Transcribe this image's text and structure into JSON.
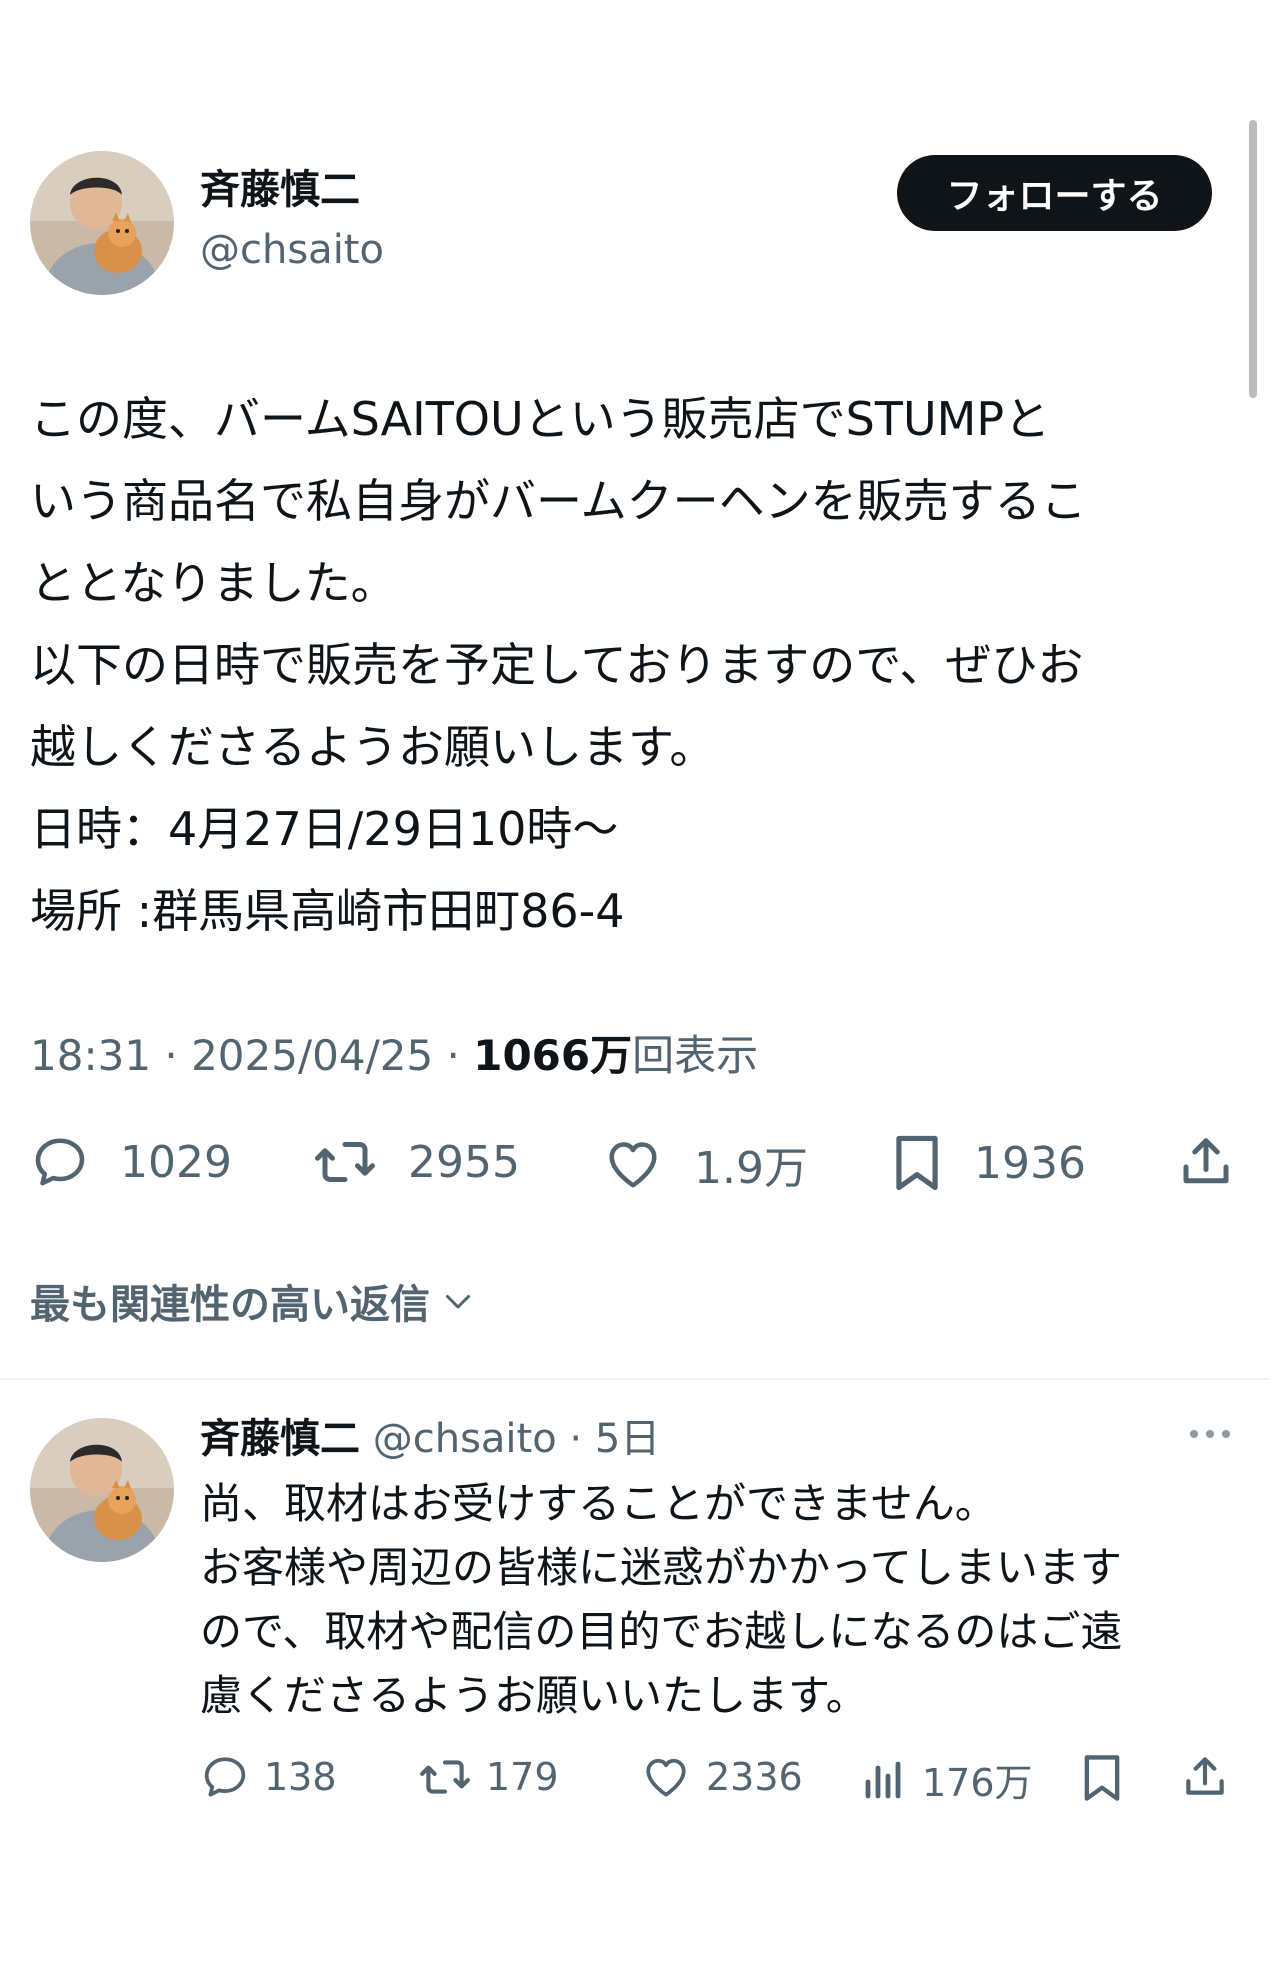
{
  "tweet": {
    "author_name": "斉藤慎二",
    "author_handle": "@chsaito",
    "follow_label": "フォローする",
    "body_lines": [
      "この度、バームSAITOUという販売店でSTUMPと",
      "いう商品名で私自身がバームクーヘンを販売するこ",
      "ととなりました。",
      "以下の日時で販売を予定しておりますので、ぜひお",
      "越しくださるようお願いします。",
      "日時：4月27日/29日10時〜",
      "場所 :群馬県高崎市田町86-4"
    ],
    "time": "18:31 · 2025/04/25 · ",
    "views_count": "1066万",
    "views_label": "回表示",
    "actions": {
      "replies": "1029",
      "retweets": "2955",
      "likes": "1.9万",
      "bookmarks": "1936"
    }
  },
  "replies_sort_label": "最も関連性の高い返信",
  "reply": {
    "author_name": "斉藤慎二",
    "author_handle": "@chsaito",
    "separator": " · ",
    "time": "5日",
    "body_lines": [
      "尚、取材はお受けすることができません。",
      "お客様や周辺の皆様に迷惑がかかってしまいます",
      "ので、取材や配信の目的でお越しになるのはご遠",
      "慮くださるようお願いいたします。"
    ],
    "actions": {
      "replies": "138",
      "retweets": "179",
      "likes": "2336",
      "views": "176万"
    }
  },
  "colors": {
    "text_primary": "#0f1419",
    "text_secondary": "#536471",
    "button_bg": "#0f1419",
    "divider": "#eff3f4"
  }
}
